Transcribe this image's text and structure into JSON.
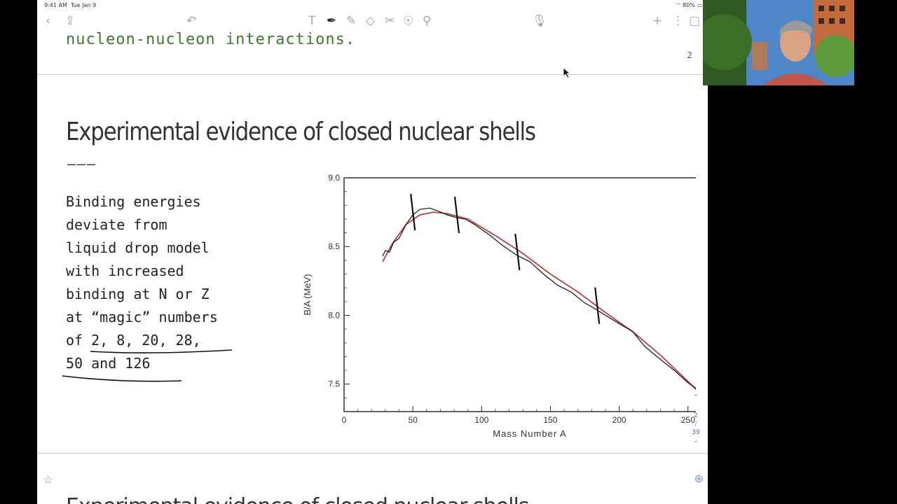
{
  "status_bar": {
    "time": "9:41 AM",
    "date": "Tue Jan 9",
    "battery": "80%"
  },
  "toolbar": {
    "icons": [
      "back-icon",
      "share-icon",
      "undo-icon",
      "text-tool-icon",
      "pen-tool-icon",
      "highlighter-icon",
      "eraser-icon",
      "scissors-icon",
      "shape-icon",
      "search-icon",
      "microphone-icon",
      "add-icon",
      "more-icon",
      "pages-icon"
    ]
  },
  "document": {
    "previous_line": "nucleon-nucleon interactions.",
    "page_number": "2",
    "heading": "Experimental evidence of closed nuclear shells",
    "separator": "———",
    "body_lines": [
      "Binding energies",
      "deviate from",
      "liquid drop model",
      "with increased",
      "binding at N or Z",
      "at “magic” numbers",
      "of 2, 8, 20, 28,",
      "50 and 126"
    ],
    "next_heading": "Experimental evidence of closed nuclear shells"
  },
  "page_indicator": {
    "current": "2",
    "total": "39"
  },
  "chart_data": {
    "type": "line",
    "xlabel": "Mass Number A",
    "ylabel": "B/A (MeV)",
    "xlim": [
      0,
      270
    ],
    "ylim": [
      7.3,
      9.0
    ],
    "x_ticks": [
      "0",
      "50",
      "100",
      "150",
      "200",
      "250"
    ],
    "y_ticks": [
      "9.0",
      "8.5",
      "8.0",
      "7.5"
    ],
    "series": [
      {
        "color": "#b84040",
        "points": [
          [
            28,
            8.39
          ],
          [
            35,
            8.52
          ],
          [
            45,
            8.66
          ],
          [
            55,
            8.73
          ],
          [
            65,
            8.75
          ],
          [
            75,
            8.74
          ],
          [
            90,
            8.7
          ],
          [
            110,
            8.58
          ],
          [
            130,
            8.45
          ],
          [
            150,
            8.3
          ],
          [
            170,
            8.17
          ],
          [
            190,
            8.02
          ],
          [
            210,
            7.88
          ],
          [
            230,
            7.71
          ],
          [
            250,
            7.52
          ],
          [
            262,
            7.4
          ]
        ]
      },
      {
        "color": "#111111",
        "points": [
          [
            28,
            8.43
          ],
          [
            30,
            8.47
          ],
          [
            33,
            8.46
          ],
          [
            36,
            8.53
          ],
          [
            40,
            8.56
          ],
          [
            45,
            8.66
          ],
          [
            50,
            8.73
          ],
          [
            55,
            8.77
          ],
          [
            62,
            8.78
          ],
          [
            68,
            8.76
          ],
          [
            75,
            8.73
          ],
          [
            82,
            8.71
          ],
          [
            88,
            8.7
          ],
          [
            95,
            8.66
          ],
          [
            105,
            8.59
          ],
          [
            115,
            8.51
          ],
          [
            125,
            8.44
          ],
          [
            135,
            8.39
          ],
          [
            145,
            8.3
          ],
          [
            155,
            8.22
          ],
          [
            165,
            8.17
          ],
          [
            175,
            8.09
          ],
          [
            182,
            8.05
          ],
          [
            190,
            8.0
          ],
          [
            200,
            7.94
          ],
          [
            210,
            7.88
          ],
          [
            218,
            7.78
          ],
          [
            225,
            7.72
          ],
          [
            240,
            7.6
          ],
          [
            250,
            7.51
          ],
          [
            260,
            7.44
          ]
        ]
      }
    ]
  }
}
